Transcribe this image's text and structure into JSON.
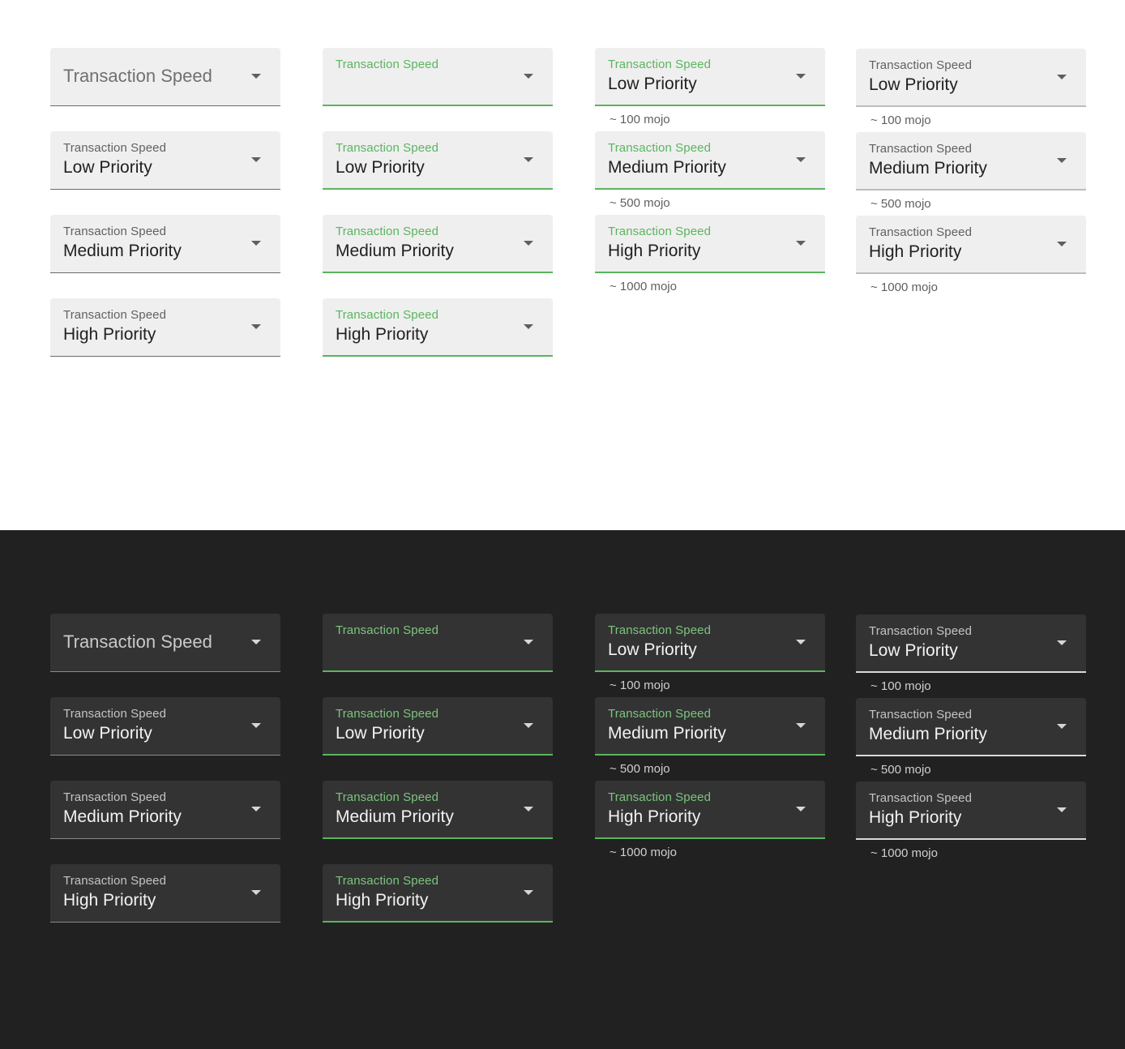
{
  "label": "Transaction Speed",
  "options": {
    "low": "Low Priority",
    "medium": "Medium Priority",
    "high": "High Priority"
  },
  "helpers": {
    "low": "~ 100 mojo",
    "medium": "~ 500 mojo",
    "high": "~ 1000 mojo"
  },
  "colors": {
    "accent_green": "#5ab55e",
    "light_bg": "#ffffff",
    "dark_bg": "#212121",
    "light_field": "#efefef",
    "dark_field": "#333333"
  },
  "icons": {
    "dropdown": "arrow-drop-down-icon"
  }
}
